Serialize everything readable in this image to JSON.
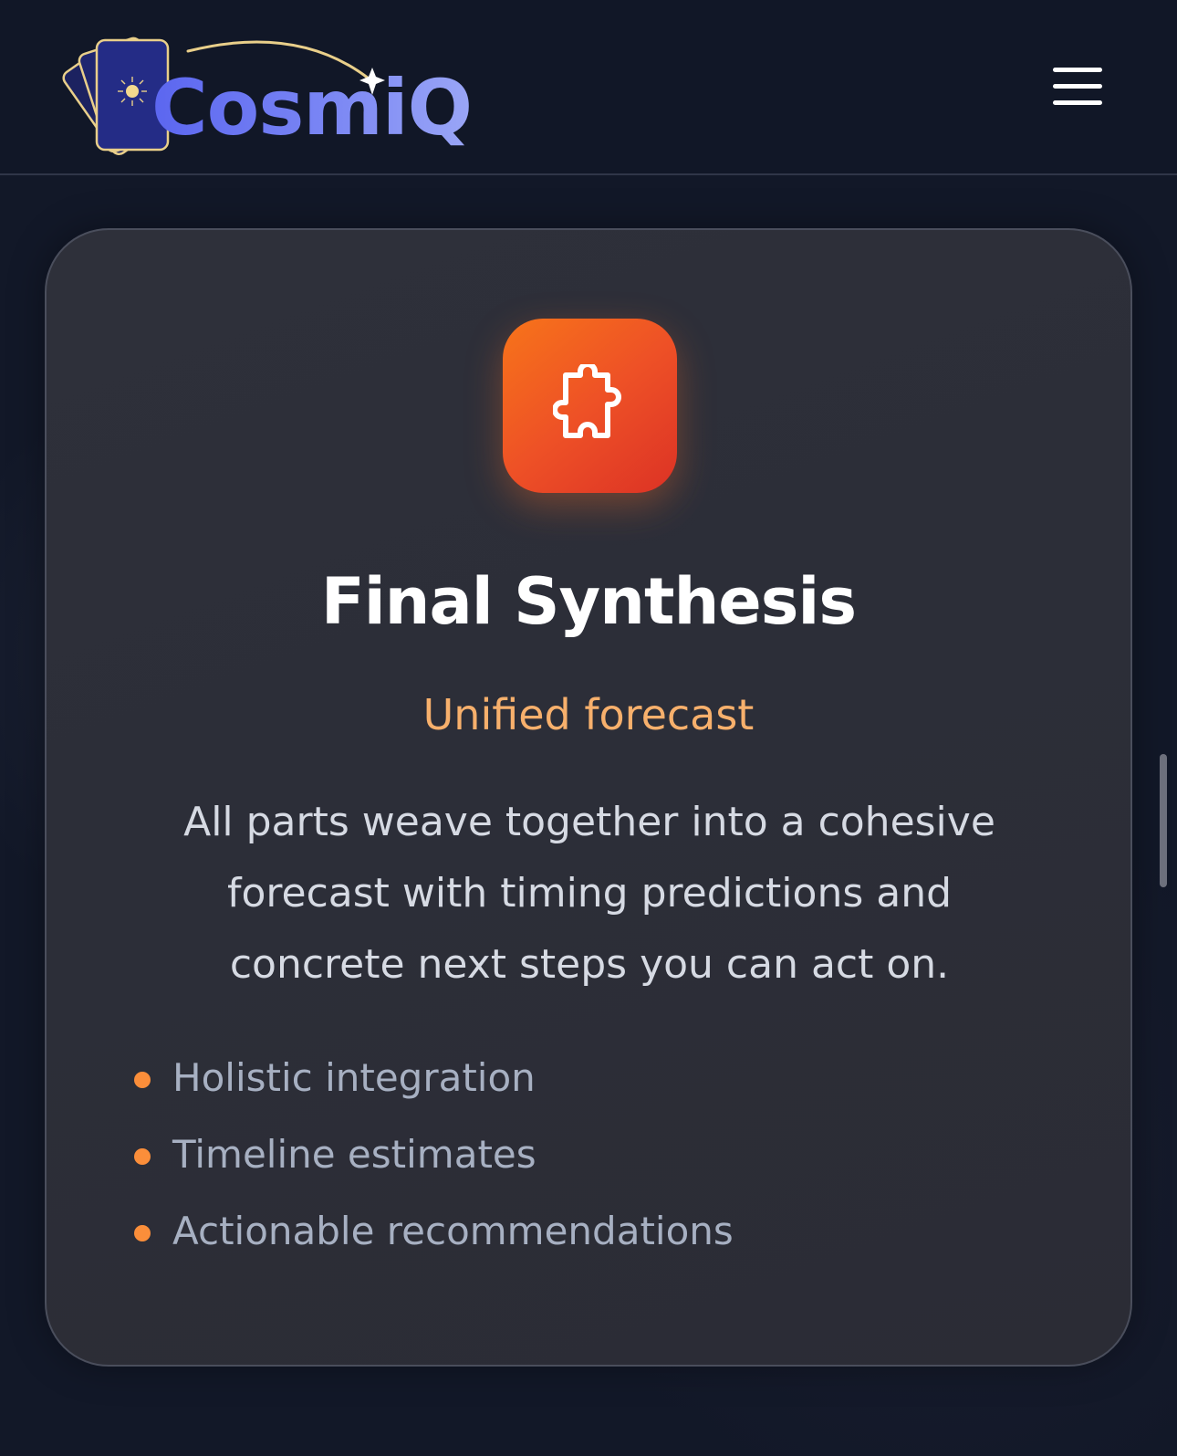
{
  "header": {
    "logo_text": "CosmiQ",
    "menu_icon": "hamburger-menu-icon"
  },
  "card": {
    "icon": "puzzle-piece-icon",
    "title": "Final Synthesis",
    "subtitle": "Unified forecast",
    "description": "All parts weave together into a cohesive forecast with timing predictions and concrete next steps you can act on.",
    "features": [
      "Holistic integration",
      "Timeline estimates",
      "Actionable recommendations"
    ]
  },
  "colors": {
    "background": "#121828",
    "accent_orange": "#f7741a",
    "subtitle": "#f7b06c",
    "bullet": "#fb8e3a",
    "logo_gradient_start": "#5b66f0",
    "logo_gradient_end": "#9aa6f6"
  }
}
